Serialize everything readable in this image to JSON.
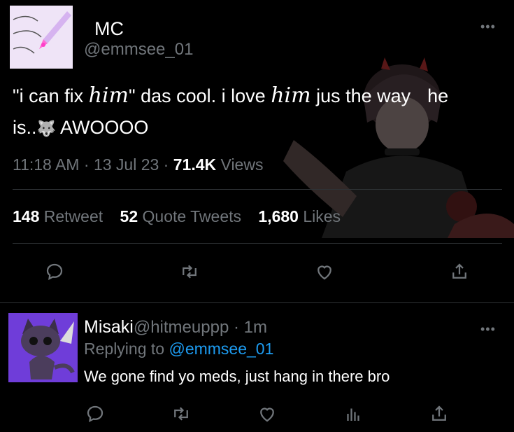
{
  "tweet": {
    "author_name": "MC",
    "author_handle": "@emmsee_01",
    "more_icon": "more-horizontal-icon",
    "text_part1": "\"i can fix ",
    "text_hw1": "him",
    "text_part2": "\" das cool. i love ",
    "text_hw2": "him",
    "text_part3": "jus the way",
    "text_part4": "he",
    "text_line2": "is..",
    "text_emoji": "🐺",
    "text_line2_end": "AWOOOO",
    "time": "11:18 AM",
    "date": "13 Jul 23",
    "views_count": "71.4K",
    "views_label": "Views",
    "retweets_count": "148",
    "retweets_label": "Retweet",
    "quotes_count": "52",
    "quotes_label": "Quote Tweets",
    "likes_count": "1,680",
    "likes_label": "Likes"
  },
  "reply": {
    "author_name": "Misaki",
    "author_handle": "@hitmeuppp",
    "time": "1m",
    "replying_to_label": "Replying to",
    "replying_to_handle": "@emmsee_01",
    "text": "We gone find yo meds, just hang in there bro"
  },
  "colors": {
    "background": "#000000",
    "text": "#e7e9ea",
    "muted": "#71767b",
    "link": "#1d9bf0"
  }
}
